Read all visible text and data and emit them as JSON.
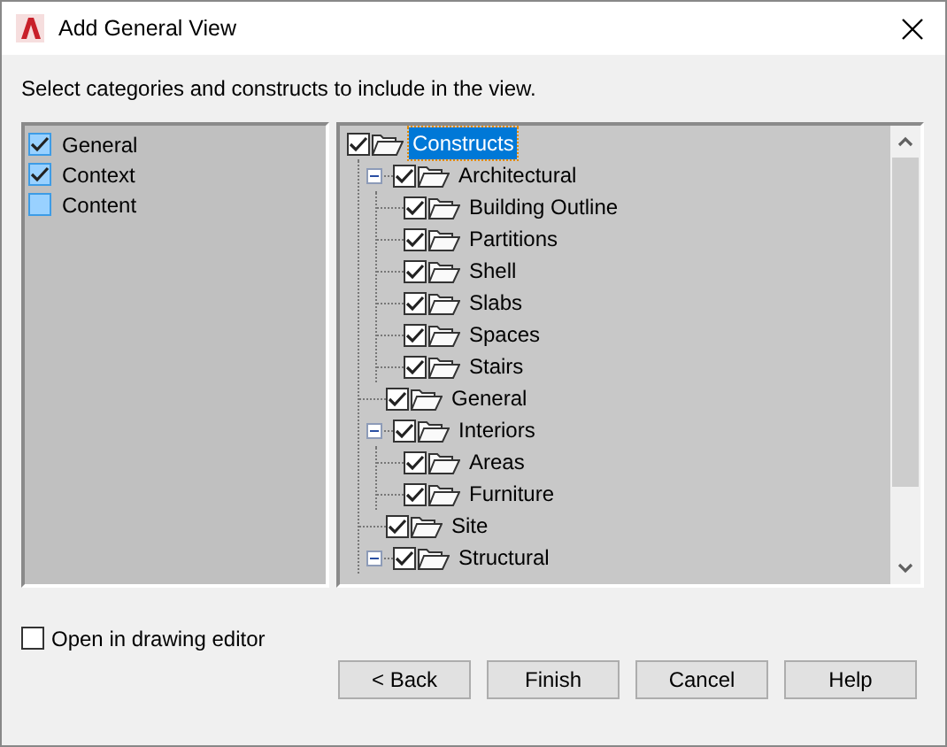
{
  "window": {
    "title": "Add General View"
  },
  "instruction": "Select categories and constructs to include in the view.",
  "categories": [
    {
      "label": "General",
      "checked": true
    },
    {
      "label": "Context",
      "checked": true
    },
    {
      "label": "Content",
      "checked": false
    }
  ],
  "tree": [
    {
      "label": "Constructs",
      "checked": true,
      "selected": true,
      "children": [
        {
          "label": "Architectural",
          "checked": true,
          "selected": false,
          "expanded": true,
          "children": [
            {
              "label": "Building Outline",
              "checked": true,
              "selected": false
            },
            {
              "label": "Partitions",
              "checked": true,
              "selected": false
            },
            {
              "label": "Shell",
              "checked": true,
              "selected": false
            },
            {
              "label": "Slabs",
              "checked": true,
              "selected": false
            },
            {
              "label": "Spaces",
              "checked": true,
              "selected": false
            },
            {
              "label": "Stairs",
              "checked": true,
              "selected": false
            }
          ]
        },
        {
          "label": "General",
          "checked": true,
          "selected": false
        },
        {
          "label": "Interiors",
          "checked": true,
          "selected": false,
          "expanded": true,
          "children": [
            {
              "label": "Areas",
              "checked": true,
              "selected": false
            },
            {
              "label": "Furniture",
              "checked": true,
              "selected": false
            }
          ]
        },
        {
          "label": "Site",
          "checked": true,
          "selected": false
        },
        {
          "label": "Structural",
          "checked": true,
          "selected": false,
          "expanded": true
        }
      ]
    }
  ],
  "open_in_editor": {
    "label": "Open in drawing editor",
    "checked": false
  },
  "buttons": [
    "< Back",
    "Finish",
    "Cancel",
    "Help"
  ]
}
